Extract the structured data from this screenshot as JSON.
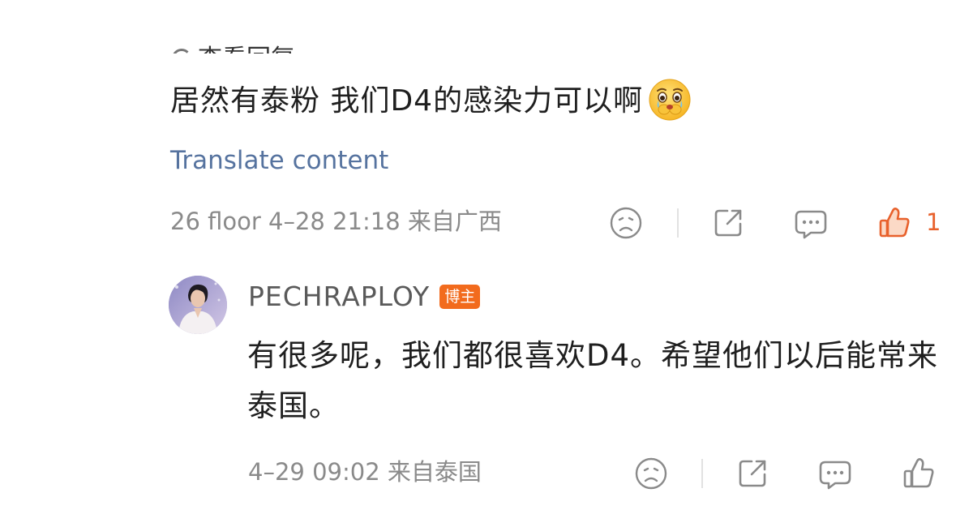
{
  "cut_off_text": "查看回复",
  "comment": {
    "text": "居然有泰粉 我们D4的感染力可以啊",
    "emoji": "crying-face-emoji",
    "translate_label": "Translate content",
    "meta": "26 floor 4–28 21:18  来自广西",
    "like_count": "1",
    "like_color": "#e8612c"
  },
  "reply": {
    "author": "PECHRAPLOY",
    "badge": "博主",
    "badge_color": "#f26b1d",
    "text": "有很多呢，我们都很喜欢D4。希望他们以后能常来泰国。",
    "meta": "4–29 09:02  来自泰国"
  },
  "colors": {
    "link": "#56739f",
    "meta": "#8a8a8a",
    "icon": "#8a8a8a"
  },
  "icons": [
    "dislike-icon",
    "share-icon",
    "comment-icon",
    "like-icon"
  ]
}
